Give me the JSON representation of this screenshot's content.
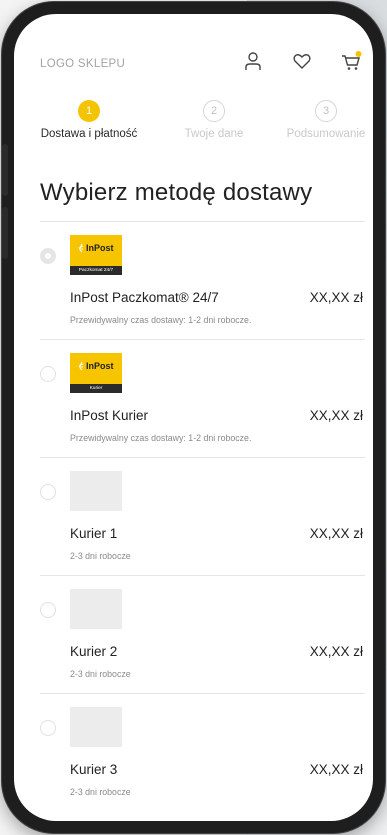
{
  "header": {
    "logo": "LOGO SKLEPU",
    "accent": "#f5c400"
  },
  "steps": [
    {
      "number": "1",
      "label": "Dostawa i płatność",
      "state": "active"
    },
    {
      "number": "2",
      "label": "Twoje dane",
      "state": "inactive"
    },
    {
      "number": "3",
      "label": "Podsumowanie",
      "state": "inactive"
    }
  ],
  "title": "Wybierz metodę dostawy",
  "options": [
    {
      "name": "InPost Paczkomat® 24/7",
      "price": "XX,XX zł",
      "desc": "Przewidywalny czas dostawy: 1-2 dni robocze.",
      "logo_word": "InPost",
      "logo_band": "Paczkomat 24/7",
      "selected": true
    },
    {
      "name": "InPost Kurier",
      "price": "XX,XX zł",
      "desc": "Przewidywalny czas dostawy: 1-2 dni robocze.",
      "logo_word": "InPost",
      "logo_band": "Kurier",
      "selected": false
    },
    {
      "name": "Kurier 1",
      "price": "XX,XX zł",
      "desc": "2-3 dni robocze",
      "selected": false
    },
    {
      "name": "Kurier 2",
      "price": "XX,XX zł",
      "desc": "2-3 dni robocze",
      "selected": false
    },
    {
      "name": "Kurier 3",
      "price": "XX,XX zł",
      "desc": "2-3 dni robocze",
      "selected": false
    }
  ]
}
